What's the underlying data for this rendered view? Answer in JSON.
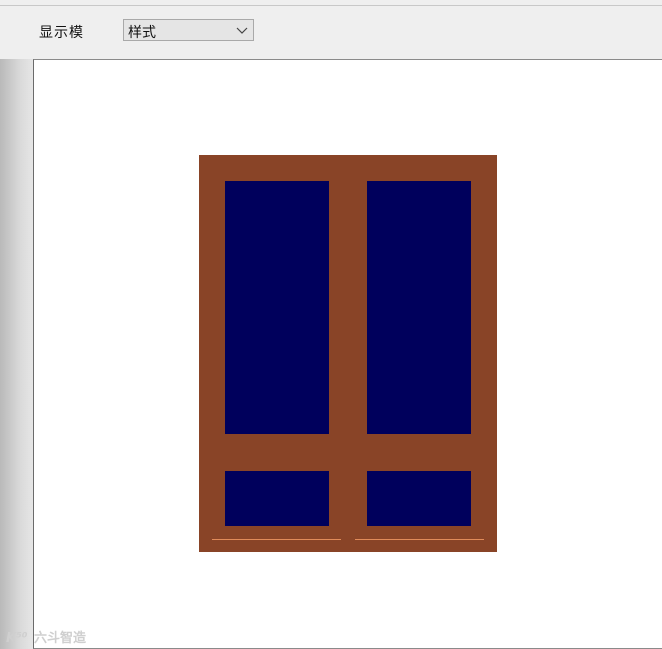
{
  "toolbar": {
    "display_mode_label": "显示模",
    "mode_select": {
      "value": "样式"
    }
  },
  "drawing": {
    "frame_color": "#894427",
    "glass_color": "#00005c",
    "sill_color": "#e08b5a"
  },
  "watermark": {
    "logo_text": "K⁵⁰",
    "text": "六斗智造"
  }
}
